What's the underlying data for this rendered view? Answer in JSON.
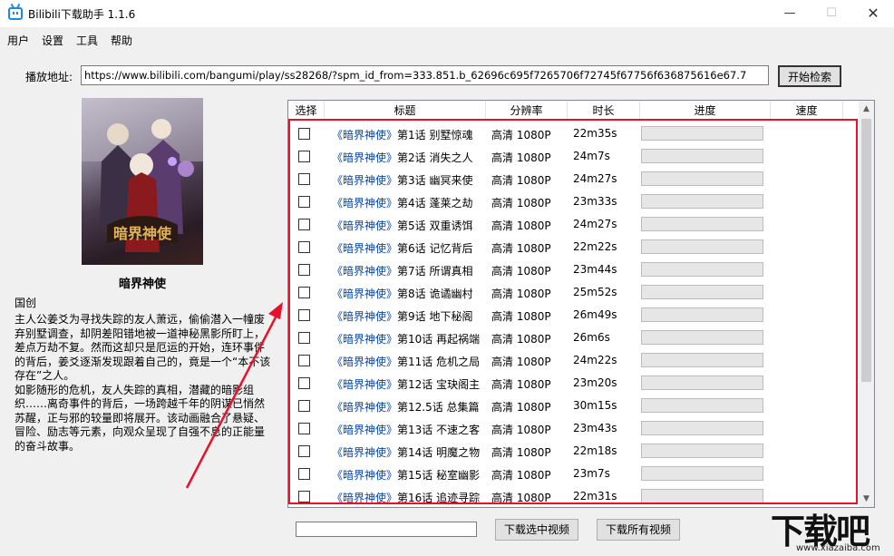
{
  "window": {
    "title": "Bilibili下载助手 1.1.6",
    "controls": {
      "minimize": "—",
      "maximize": "☐",
      "close": "✕"
    }
  },
  "menu": [
    "用户",
    "设置",
    "工具",
    "帮助"
  ],
  "address": {
    "label": "播放地址:",
    "value": "https://www.bilibili.com/bangumi/play/ss28268/?spm_id_from=333.851.b_62696c695f7265706f72745f67756f636875616e67.7",
    "search_button": "开始检索"
  },
  "info": {
    "title": "暗界神使",
    "region": "国创",
    "description": "主人公姜爻为寻找失踪的友人萧远，偷偷潜入一幢废弃别墅调查，却阴差阳错地被一道神秘黑影所盯上，差点万劫不复。然而这却只是厄运的开始，连环事件的背后，姜爻逐渐发现跟着自己的，竟是一个“本不该存在”之人。\n如影随形的危机，友人失踪的真相，潜藏的暗影组织……离奇事件的背后，一场跨越千年的阴谋已悄然苏醒，正与邪的较量即将展开。该动画融合了悬疑、冒险、励志等元素，向观众呈现了自强不息的正能量的奋斗故事。"
  },
  "table": {
    "columns": [
      "选择",
      "标题",
      "分辨率",
      "时长",
      "进度",
      "速度"
    ],
    "rows": [
      {
        "series": "《暗界神使》",
        "title": "第1话 别墅惊魂",
        "resolution": "高清 1080P",
        "duration": "22m35s",
        "progress": 0,
        "speed": ""
      },
      {
        "series": "《暗界神使》",
        "title": "第2话 消失之人",
        "resolution": "高清 1080P",
        "duration": "24m7s",
        "progress": 0,
        "speed": ""
      },
      {
        "series": "《暗界神使》",
        "title": "第3话 幽冥来使",
        "resolution": "高清 1080P",
        "duration": "24m27s",
        "progress": 0,
        "speed": ""
      },
      {
        "series": "《暗界神使》",
        "title": "第4话 蓬莱之劫",
        "resolution": "高清 1080P",
        "duration": "23m33s",
        "progress": 0,
        "speed": ""
      },
      {
        "series": "《暗界神使》",
        "title": "第5话 双重诱饵",
        "resolution": "高清 1080P",
        "duration": "24m27s",
        "progress": 0,
        "speed": ""
      },
      {
        "series": "《暗界神使》",
        "title": "第6话 记忆背后",
        "resolution": "高清 1080P",
        "duration": "22m22s",
        "progress": 0,
        "speed": ""
      },
      {
        "series": "《暗界神使》",
        "title": "第7话 所谓真相",
        "resolution": "高清 1080P",
        "duration": "23m44s",
        "progress": 0,
        "speed": ""
      },
      {
        "series": "《暗界神使》",
        "title": "第8话 诡谲幽村",
        "resolution": "高清 1080P",
        "duration": "25m52s",
        "progress": 0,
        "speed": ""
      },
      {
        "series": "《暗界神使》",
        "title": "第9话 地下秘阁",
        "resolution": "高清 1080P",
        "duration": "26m49s",
        "progress": 0,
        "speed": ""
      },
      {
        "series": "《暗界神使》",
        "title": "第10话 再起祸端",
        "resolution": "高清 1080P",
        "duration": "26m6s",
        "progress": 0,
        "speed": ""
      },
      {
        "series": "《暗界神使》",
        "title": "第11话 危机之局",
        "resolution": "高清 1080P",
        "duration": "24m22s",
        "progress": 0,
        "speed": ""
      },
      {
        "series": "《暗界神使》",
        "title": "第12话 宝玦阁主",
        "resolution": "高清 1080P",
        "duration": "23m20s",
        "progress": 0,
        "speed": ""
      },
      {
        "series": "《暗界神使》",
        "title": "第12.5话 总集篇",
        "resolution": "高清 1080P",
        "duration": "30m15s",
        "progress": 0,
        "speed": ""
      },
      {
        "series": "《暗界神使》",
        "title": "第13话 不速之客",
        "resolution": "高清 1080P",
        "duration": "23m43s",
        "progress": 0,
        "speed": ""
      },
      {
        "series": "《暗界神使》",
        "title": "第14话 明魔之物",
        "resolution": "高清 1080P",
        "duration": "22m18s",
        "progress": 0,
        "speed": ""
      },
      {
        "series": "《暗界神使》",
        "title": "第15话 秘室幽影",
        "resolution": "高清 1080P",
        "duration": "23m7s",
        "progress": 0,
        "speed": ""
      },
      {
        "series": "《暗界神使》",
        "title": "第16话 追迹寻踪",
        "resolution": "高清 1080P",
        "duration": "22m31s",
        "progress": 0,
        "speed": ""
      }
    ]
  },
  "bottom": {
    "status_value": "",
    "download_selected": "下载选中视频",
    "download_all": "下载所有视频"
  },
  "watermark": {
    "main": "下载吧",
    "site": "www.xiazaiba.com"
  },
  "colors": {
    "highlight": "#e8102a",
    "app_icon": "#1e88e5"
  }
}
